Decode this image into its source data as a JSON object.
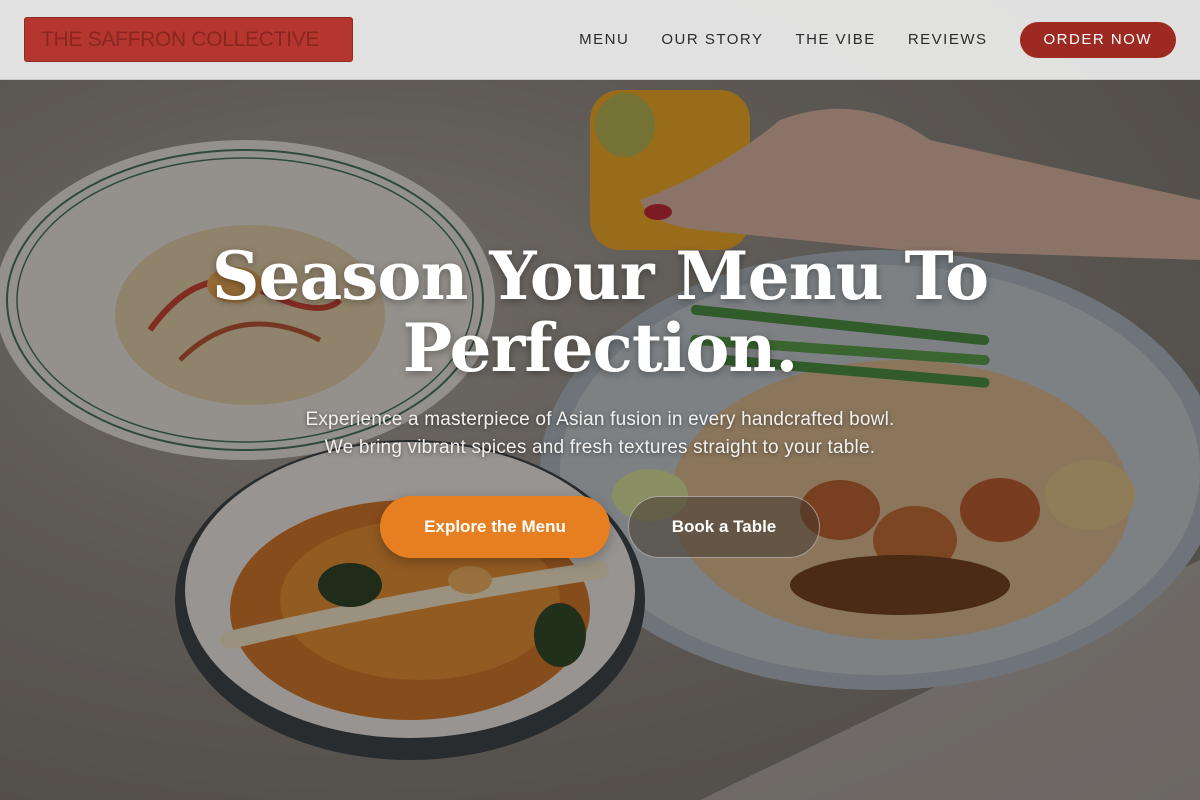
{
  "brand": {
    "name": "THE SAFFRON COLLECTIVE",
    "color": "#b5362e"
  },
  "nav": {
    "links": [
      {
        "label": "MENU"
      },
      {
        "label": "OUR STORY"
      },
      {
        "label": "THE VIBE"
      },
      {
        "label": "REVIEWS"
      }
    ],
    "order_label": "ORDER NOW",
    "order_color": "#9c2a22"
  },
  "hero": {
    "headline_line1": "Season Your Menu To",
    "headline_line2": "Perfection.",
    "subtext_line1": "Experience a masterpiece of Asian fusion in every handcrafted bowl.",
    "subtext_line2": "We bring vibrant spices and fresh textures straight to your table.",
    "primary_cta": "Explore the Menu",
    "primary_color": "#e67e22",
    "secondary_cta": "Book a Table",
    "background_image": "food-spread-image"
  }
}
